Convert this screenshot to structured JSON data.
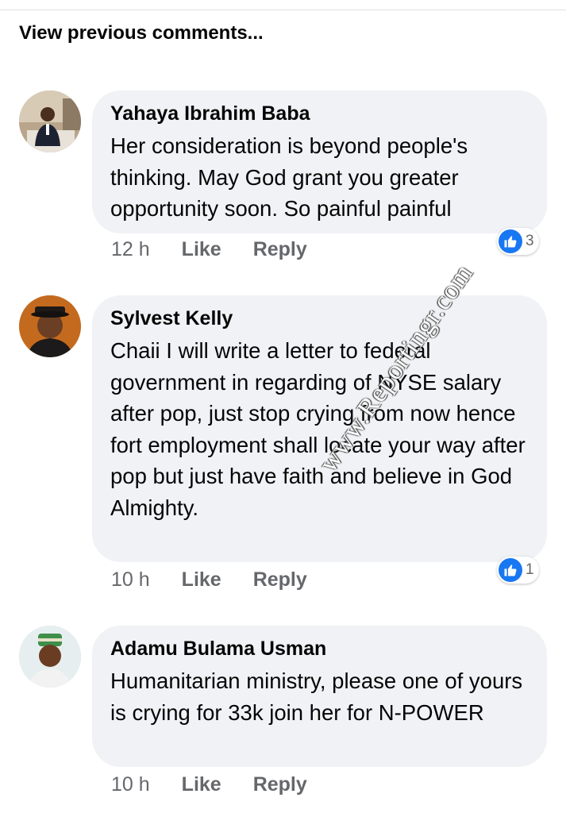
{
  "view_previous_label": "View previous comments...",
  "comments": [
    {
      "author": "Yahaya Ibrahim Baba",
      "text": "Her consideration is beyond people's thinking. May God grant you greater opportunity soon. So painful painful",
      "time": "12 h",
      "like_label": "Like",
      "reply_label": "Reply",
      "reaction_count": "3"
    },
    {
      "author": "Sylvest Kelly",
      "text": "Chaii I will write a letter to federal government in regarding of NYSE salary after pop, just stop crying from now hence fort employment shall locate your way after pop but just have faith and believe in God Almighty.",
      "time": "10 h",
      "like_label": "Like",
      "reply_label": "Reply",
      "reaction_count": "1"
    },
    {
      "author": "Adamu Bulama Usman",
      "text": "Humanitarian ministry, please one of yours is crying for 33k join her for N-POWER",
      "time": "10 h",
      "like_label": "Like",
      "reply_label": "Reply"
    }
  ],
  "watermark": "www.Reportingr.com",
  "colors": {
    "bubble": "#f0f2f5",
    "like_blue": "#1877f2",
    "meta_gray": "#65676b"
  }
}
